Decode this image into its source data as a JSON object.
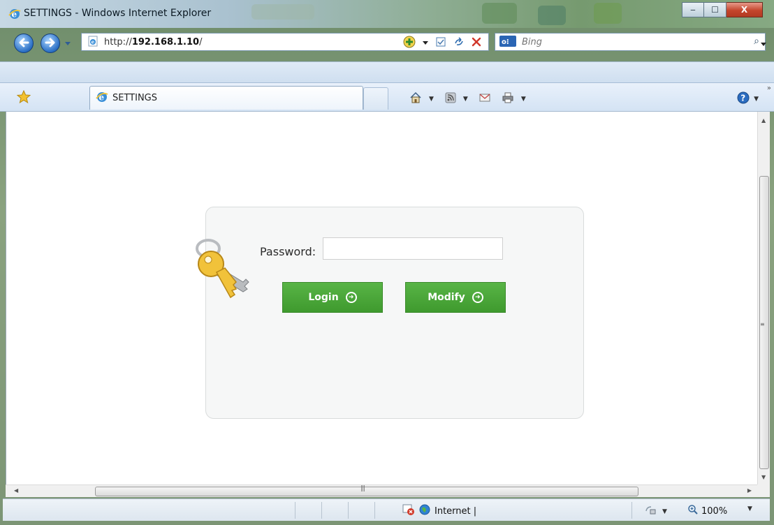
{
  "window": {
    "title": "SETTINGS - Windows Internet Explorer",
    "minimize_label": "‒",
    "maximize_label": "☐",
    "close_label": "X"
  },
  "nav": {
    "url_prefix": "http://",
    "url_host": "192.168.1.10",
    "url_suffix": "/",
    "search_placeholder": "Bing"
  },
  "tab": {
    "label": "SETTINGS"
  },
  "login": {
    "password_label": "Password:",
    "password_value": "",
    "login_label": "Login",
    "modify_label": "Modify"
  },
  "status": {
    "zone_label": "Internet |",
    "zoom_label": "100%"
  },
  "colors": {
    "button_green": "#4aa83a",
    "panel_bg": "#f6f7f7",
    "chrome_blue": "#dbe7f4"
  },
  "icons": [
    "ie-icon",
    "back-icon",
    "forward-icon",
    "page-icon",
    "compat-icon",
    "refresh-icon",
    "stop-icon",
    "bing-icon",
    "search-icon",
    "favorites-star-icon",
    "home-icon",
    "feeds-icon",
    "mail-icon",
    "print-icon",
    "help-icon",
    "key-icon",
    "globe-icon",
    "zoom-icon"
  ]
}
